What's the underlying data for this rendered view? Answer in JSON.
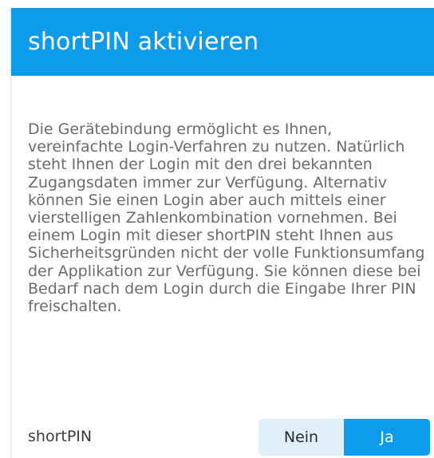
{
  "dialog": {
    "title": "shortPIN aktivieren",
    "body": "Die Gerätebindung ermöglicht es Ihnen, vereinfachte Login-Verfahren zu nutzen. Natürlich steht Ihnen der Login mit den drei bekannten Zugangsdaten immer zur Verfügung. Alternativ können Sie einen Login aber auch mittels einer vierstelligen Zahlenkombination vornehmen. Bei einem Login mit dieser shortPIN steht Ihnen aus Sicherheitsgründen nicht der volle Funktionsumfang der Applikation zur Verfügung. Sie können diese bei Bedarf nach dem Login durch die Eingabe Ihrer PIN freischalten."
  },
  "setting": {
    "label": "shortPIN",
    "options": {
      "no": "Nein",
      "yes": "Ja"
    },
    "selected": "Ja"
  },
  "colors": {
    "accent": "#0d9bec",
    "toggle_inactive": "#dff0fb",
    "body_text": "#6b6b6b"
  }
}
